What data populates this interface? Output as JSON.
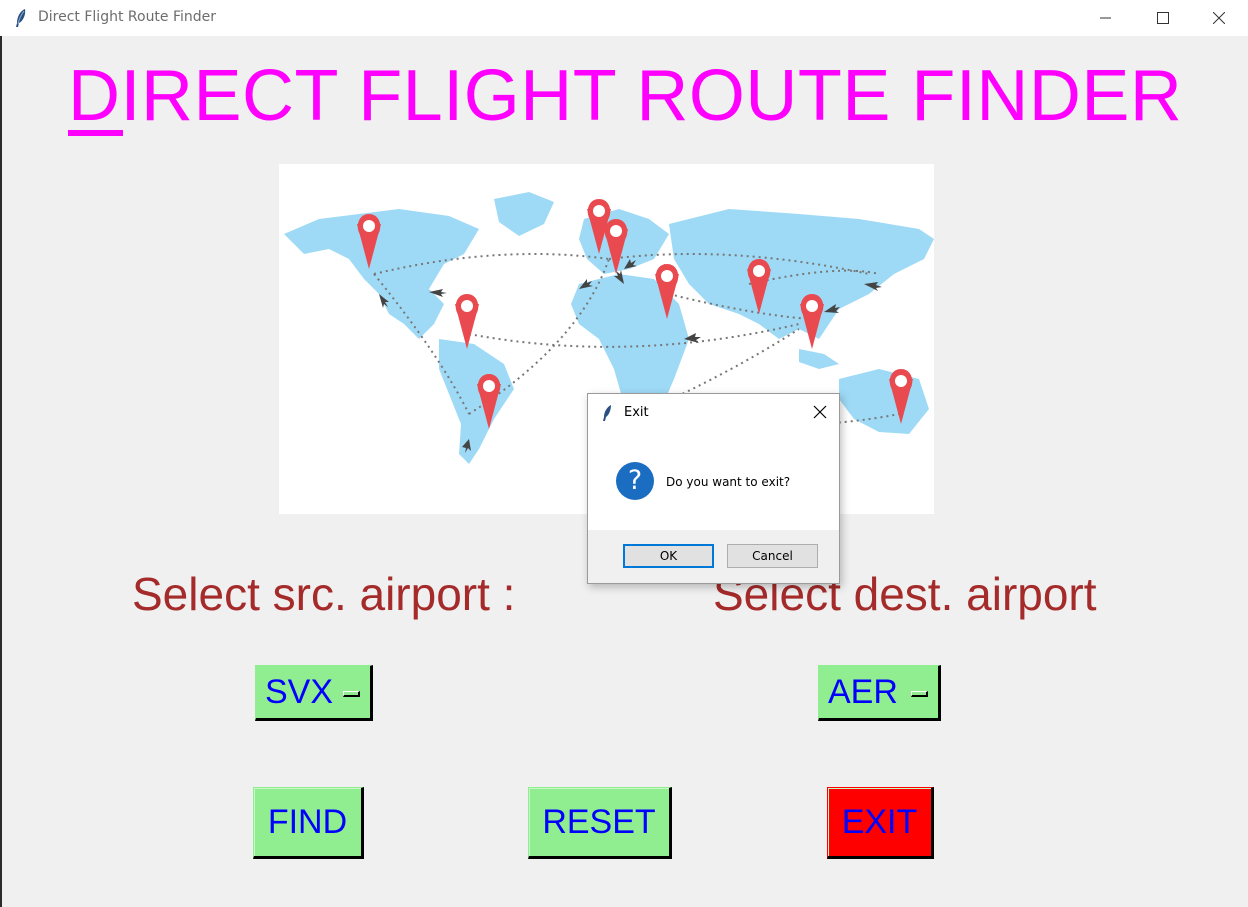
{
  "window": {
    "title": "Direct Flight Route Finder"
  },
  "heading": "DIRECT FLIGHT ROUTE FINDER",
  "src_label": "Select src. airport :",
  "dest_label": "Select dest. airport",
  "src_airport": "SVX",
  "dest_airport": "AER",
  "buttons": {
    "find": "FIND",
    "reset": "RESET",
    "exit": "EXIT"
  },
  "dialog": {
    "title": "Exit",
    "message": "Do you want to exit?",
    "ok": "OK",
    "cancel": "Cancel"
  },
  "colors": {
    "heading": "#ff00ff",
    "labels": "#a52a2a",
    "buttons": "#90ee90",
    "button_text": "#0000ff",
    "exit_button": "#ff0000"
  }
}
